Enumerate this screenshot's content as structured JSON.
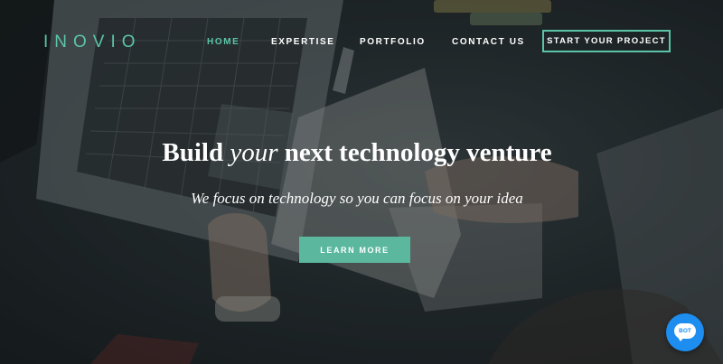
{
  "brand": {
    "logo_text": "INOVIO",
    "accent_color": "#5bc4a8"
  },
  "nav": {
    "items": [
      {
        "label": "HOME",
        "active": true
      },
      {
        "label": "EXPERTISE",
        "active": false
      },
      {
        "label": "PORTFOLIO",
        "active": false
      },
      {
        "label": "CONTACT US",
        "active": false
      }
    ],
    "cta_label": "START YOUR PROJECT"
  },
  "hero": {
    "headline_before": "Build",
    "headline_emphasis": "your",
    "headline_after": "next technology venture",
    "subheadline": "We focus on technology so you can focus on your idea",
    "button_label": "LEARN MORE",
    "button_color": "#5bb89e"
  },
  "chat": {
    "label": "BOT",
    "color": "#1d8ef0",
    "icon": "chat-bubble-icon"
  },
  "background": {
    "description_icon": "desk-photo-laptop-notes"
  }
}
